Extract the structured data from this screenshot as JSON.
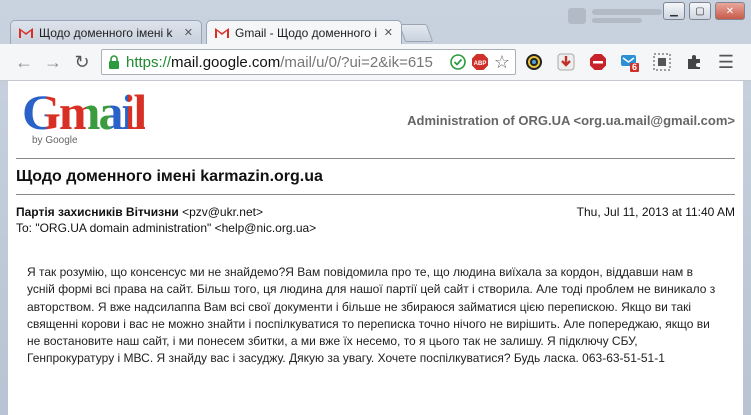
{
  "browser": {
    "tabs": [
      {
        "title": "Щодо доменного імені k"
      },
      {
        "title": "Gmail - Щодо доменного і"
      }
    ],
    "url": {
      "scheme": "https://",
      "host": "mail.google.com",
      "path": "/mail/u/0/?ui=2&ik=615"
    },
    "extension_badge": "6",
    "icons": [
      "back-icon",
      "forward-icon",
      "reload-icon",
      "lock-icon",
      "check-icon",
      "adblock-icon",
      "star-icon",
      "palette-icon",
      "download-icon",
      "stop-icon",
      "mail-checker-icon",
      "screenshot-icon",
      "puzzle-icon",
      "menu-icon"
    ]
  },
  "brand": {
    "logo_text": "Gmail",
    "by_google": "by Google"
  },
  "header": {
    "account": "Administration of ORG.UA <org.ua.mail@gmail.com>"
  },
  "email": {
    "subject": "Щодо доменного імені karmazin.org.ua",
    "from_name": "Партія захисників Вітчизни",
    "from_address": "<pzv@ukr.net>",
    "date": "Thu, Jul 11, 2013 at 11:40 AM",
    "to": "To: \"ORG.UA domain administration\" <help@nic.org.ua>",
    "body": "Я так розумію, що консенсус ми не знайдемо?Я Вам повідомила про те, що людина виїхала за кордон, віддавши нам в усній формі всі права на сайт. Більш того, ця людина для нашої партії цей сайт і створила. Але тоді проблем не виникало з авторством. Я вже надсилаппа Вам всі свої документи і більше не збираюся займатися цією перепискою. Якщо ви такі священні корови і вас не можно знайти і поспілкуватися то переписка точно нічого не вирішить. Але попереджаю, якщо ви не востановите наш сайт, і ми понесем збитки, а ми вже їх несемо, то я цього так не залишу. Я підключу СБУ, Генпрокуратуру і МВС. Я знайду вас і засуджу. Дякую за увагу. Хочете поспілкуватися? Будь ласка. 063-63-51-51-1"
  }
}
